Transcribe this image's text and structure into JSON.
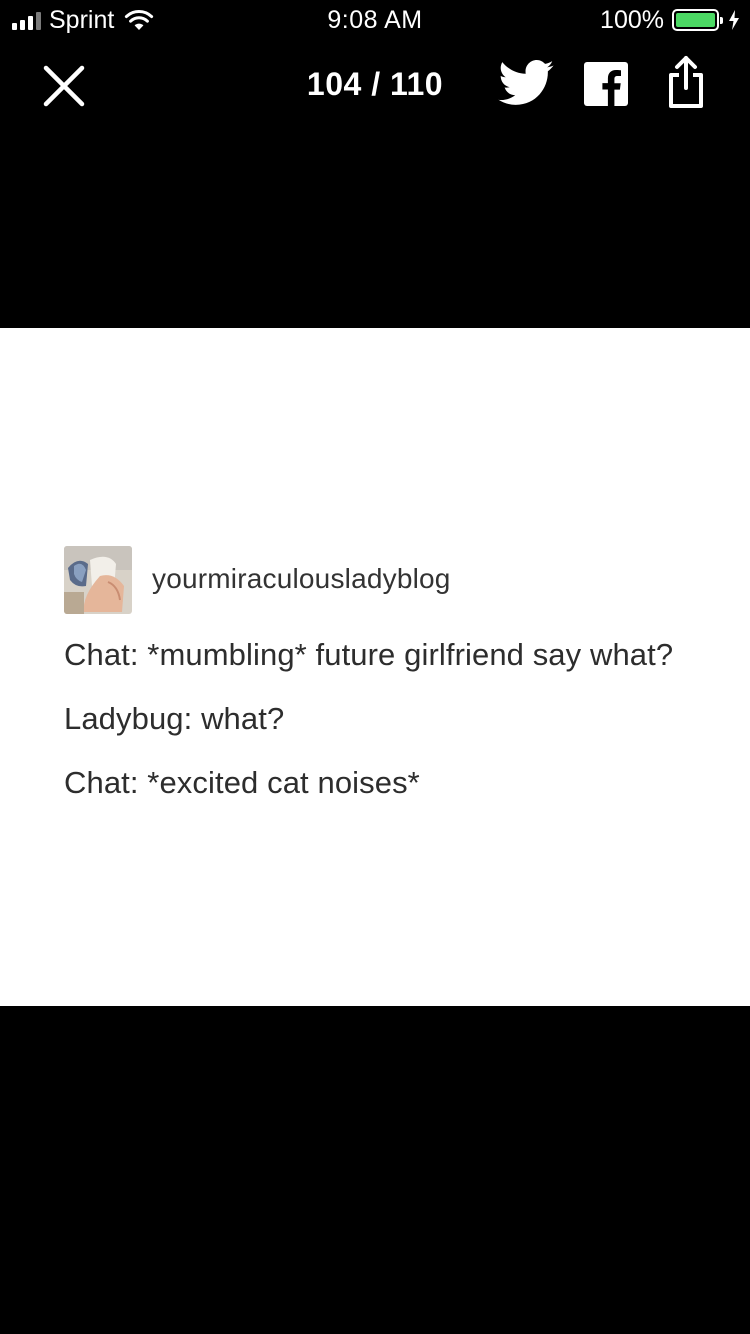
{
  "status_bar": {
    "carrier": "Sprint",
    "time": "9:08 AM",
    "battery_percent": "100%",
    "battery_level": 1.0,
    "signal_bars": 3,
    "signal_total": 4,
    "battery_color": "#4cd964",
    "charging": true,
    "icons": [
      "signal-icon",
      "wifi-icon",
      "battery-icon",
      "charging-bolt-icon"
    ]
  },
  "toolbar": {
    "counter": "104 / 110",
    "buttons": [
      "close-icon",
      "twitter-icon",
      "facebook-icon",
      "share-icon"
    ]
  },
  "post": {
    "username": "yourmiraculousladyblog",
    "lines": [
      "Chat: *mumbling* future girlfriend say what?",
      "Ladybug: what?",
      "Chat: *excited cat noises*"
    ]
  },
  "colors": {
    "background": "#000000",
    "card": "#ffffff",
    "text": "#2d2d2d"
  }
}
